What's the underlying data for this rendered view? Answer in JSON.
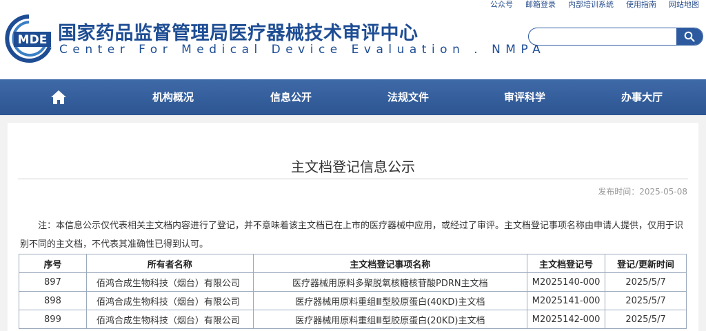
{
  "top_links": [
    "公众号",
    "邮箱登录",
    "内部培训系统",
    "使用指南",
    "网站地图"
  ],
  "logo": {
    "text": "MDE"
  },
  "header": {
    "title_cn": "国家药品监督管理局医疗器械技术审评中心",
    "title_en": "Center For Medical Device Evaluation . NMPA"
  },
  "search": {
    "value": "",
    "placeholder": ""
  },
  "nav": {
    "home_icon": "home-icon",
    "items": [
      "机构概况",
      "信息公开",
      "法规文件",
      "审评科学",
      "办事大厅"
    ]
  },
  "article": {
    "title": "主文档登记信息公示",
    "date_label": "发布时间：",
    "date_value": "2025-05-08",
    "note": "注：本信息公示仅代表相关主文档内容进行了登记，并不意味着该主文档已在上市的医疗器械中应用，或经过了审评。主文档登记事项名称由申请人提供，仅用于识别不同的主文档，不代表其准确性已得到认可。"
  },
  "table": {
    "headers": [
      "序号",
      "所有者名称",
      "主文档登记事项名称",
      "主文档登记号",
      "登记/更新时间"
    ],
    "rows": [
      [
        "897",
        "佰鸿合成生物科技（烟台）有限公司",
        "医疗器械用原料多聚脱氧核糖核苷酸PDRN主文档",
        "M2025140-000",
        "2025/5/7"
      ],
      [
        "898",
        "佰鸿合成生物科技（烟台）有限公司",
        "医疗器械用原料重组Ⅲ型胶原蛋白(40KD)主文档",
        "M2025141-000",
        "2025/5/7"
      ],
      [
        "899",
        "佰鸿合成生物科技（烟台）有限公司",
        "医疗器械用原料重组Ⅲ型胶原蛋白(20KD)主文档",
        "M2025142-000",
        "2025/5/7"
      ]
    ]
  },
  "colors": {
    "brand_blue": "#1e4d94",
    "nav_blue": "#2c5591"
  }
}
